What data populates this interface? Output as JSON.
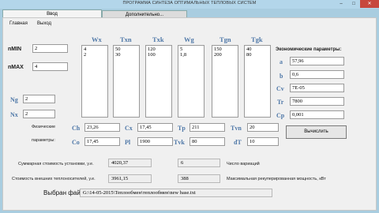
{
  "window": {
    "title": "ПРОГРАММА СИНТЕЗА ОПТИМАЛЬНЫХ ТЕПЛОВЫХ СИСТЕМ",
    "minimize_glyph": "–",
    "maximize_glyph": "□",
    "close_glyph": "✕"
  },
  "tabs": [
    {
      "label": "Ввод"
    },
    {
      "label": "Дополнительно..."
    }
  ],
  "menu": [
    {
      "label": "Главная"
    },
    {
      "label": "Выход"
    }
  ],
  "left": {
    "nmin_label": "nMIN",
    "nmin_value": "2",
    "nmax_label": "nMAX",
    "nmax_value": "4",
    "ng_label": "Ng",
    "ng_value": "2",
    "nx_label": "Nx",
    "nx_value": "2"
  },
  "columns": [
    {
      "header": "Wx",
      "values": [
        "4",
        "2"
      ]
    },
    {
      "header": "Txn",
      "values": [
        "50",
        "30"
      ]
    },
    {
      "header": "Txk",
      "values": [
        "120",
        "100"
      ]
    },
    {
      "header": "Wg",
      "values": [
        "5",
        "1,8"
      ]
    },
    {
      "header": "Tgn",
      "values": [
        "150",
        "200"
      ]
    },
    {
      "header": "Tgk",
      "values": [
        "40",
        "80"
      ]
    }
  ],
  "econ": {
    "title": "Экономические параметры:",
    "params": [
      {
        "label": "a",
        "value": "57,96"
      },
      {
        "label": "b",
        "value": "0,6"
      },
      {
        "label": "Cv",
        "value": "7E-05"
      },
      {
        "label": "Tr",
        "value": "7800"
      },
      {
        "label": "Cp",
        "value": "0,001"
      }
    ]
  },
  "physical": {
    "label_line1": "Физические",
    "label_line2": "параметры:",
    "row1": [
      {
        "label": "Ch",
        "value": "23,26"
      },
      {
        "label": "Cx",
        "value": "17,45"
      },
      {
        "label": "Tp",
        "value": "211"
      },
      {
        "label": "Tvn",
        "value": "20"
      }
    ],
    "row2": [
      {
        "label": "Co",
        "value": "17,45"
      },
      {
        "label": "Pl",
        "value": "1900"
      },
      {
        "label": "Tvk",
        "value": "80"
      },
      {
        "label": "dT",
        "value": "10"
      }
    ]
  },
  "calc_button": "Вычислить",
  "results": {
    "install_cost_label": "Суммарная стоимость установки, у.е.",
    "install_cost_value": "4020,37",
    "variants_value": "6",
    "variants_label": "Число вариаций",
    "heat_carrier_cost_label": "Стоимость внешних теплоносителей, у.е.",
    "heat_carrier_cost_value": "3961,15",
    "recup_power_value": "388",
    "recup_power_label": "Максимальная рекуперированная мощность, кВт"
  },
  "file": {
    "label": "Выбран файл:",
    "path": "G:\\14-05-2015\\Теплообмен\\теплообмен\\new base.txt"
  },
  "colors": {
    "accent_label": "#4f78a8",
    "close_button": "#c7473d"
  }
}
